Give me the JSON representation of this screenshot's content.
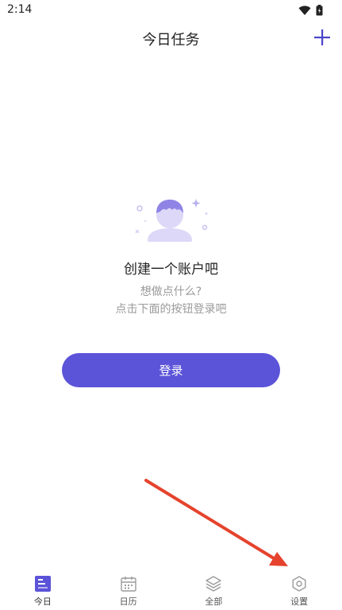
{
  "status_bar": {
    "time": "2:14",
    "icons": [
      "wifi-icon",
      "battery-icon"
    ]
  },
  "header": {
    "title": "今日任务",
    "add_icon": "plus-icon"
  },
  "empty_state": {
    "illustration": "user-avatar-illustration",
    "title": "创建一个账户吧",
    "subtitle_line1": "想做点什么?",
    "subtitle_line2": "点击下面的按钮登录吧"
  },
  "login": {
    "label": "登录"
  },
  "bottom_nav": {
    "items": [
      {
        "label": "今日",
        "icon": "today-icon",
        "active": true
      },
      {
        "label": "日历",
        "icon": "calendar-icon",
        "active": false
      },
      {
        "label": "全部",
        "icon": "layers-icon",
        "active": false
      },
      {
        "label": "设置",
        "icon": "settings-icon",
        "active": false
      }
    ]
  },
  "colors": {
    "accent": "#5b53d8",
    "annotation_arrow": "#e5432d",
    "illustration_fill": "#ddd8f7"
  }
}
